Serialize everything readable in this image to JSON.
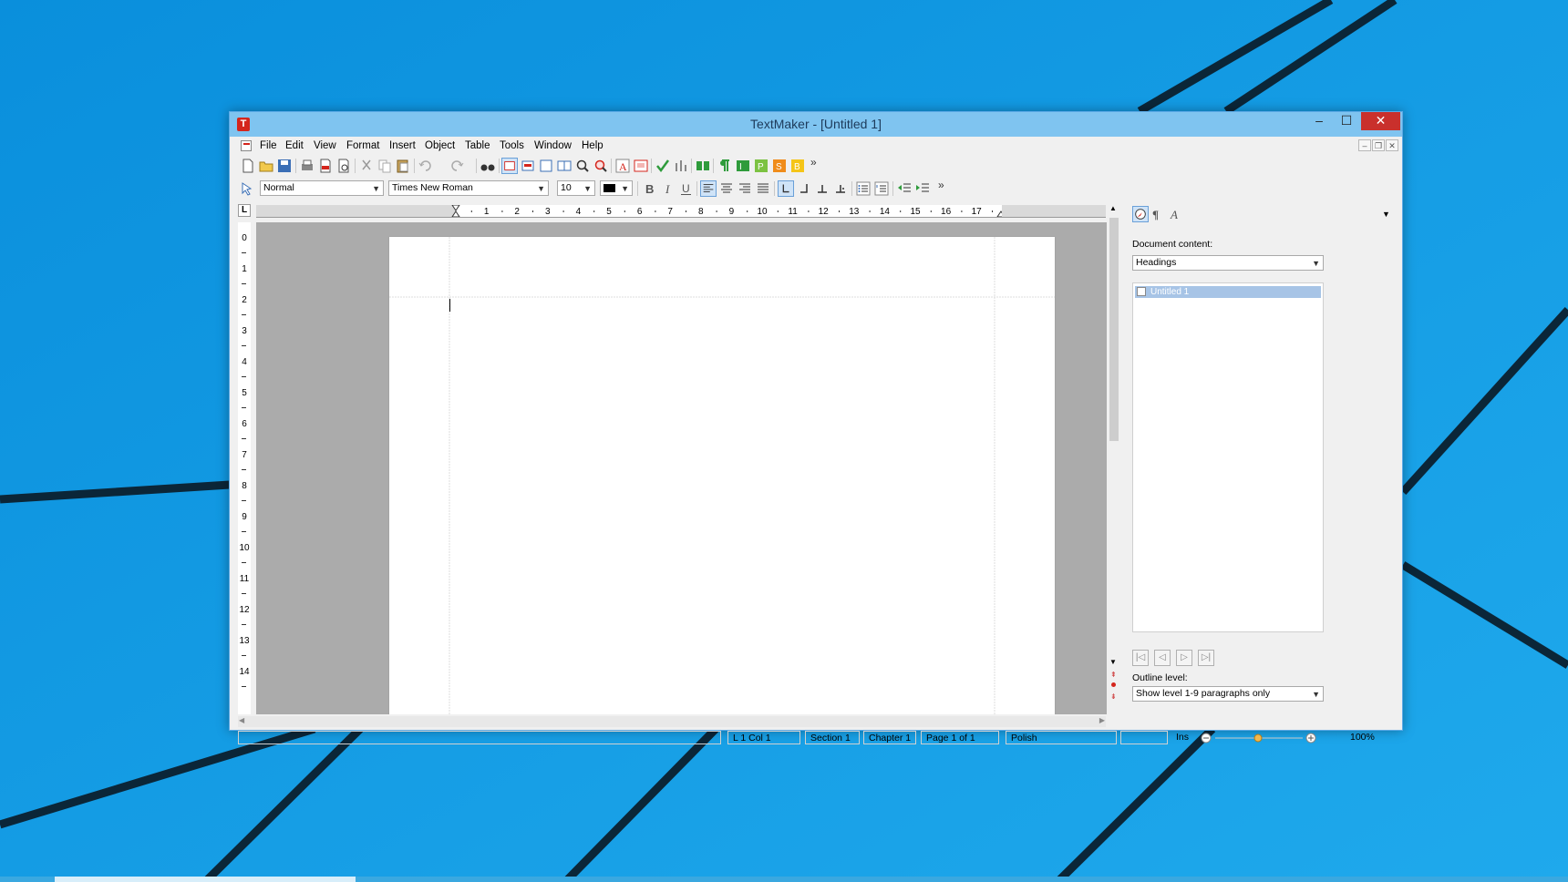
{
  "window": {
    "title": "TextMaker - [Untitled 1]",
    "app_icon_letter": "T",
    "controls": {
      "minimize": "–",
      "maximize": "☐",
      "close": "✕"
    }
  },
  "menu": [
    "File",
    "Edit",
    "View",
    "Format",
    "Insert",
    "Object",
    "Table",
    "Tools",
    "Window",
    "Help"
  ],
  "format_toolbar": {
    "paragraph_style": "Normal",
    "font_name": "Times New Roman",
    "font_size": "10"
  },
  "ruler": {
    "horizontal_labels": [
      "1",
      "2",
      "3",
      "4",
      "5",
      "6",
      "7",
      "8",
      "9",
      "10",
      "11",
      "12",
      "13",
      "14",
      "15",
      "16",
      "17"
    ],
    "vertical_labels": [
      "0",
      "1",
      "2",
      "3",
      "4",
      "5",
      "6",
      "7",
      "8",
      "9",
      "10",
      "11",
      "12",
      "13",
      "14"
    ],
    "corner": "L"
  },
  "sidebar": {
    "document_content_label": "Document content:",
    "document_content_value": "Headings",
    "list_items": [
      "Untitled 1"
    ],
    "outline_level_label": "Outline level:",
    "outline_level_value": "Show level 1-9 paragraphs only"
  },
  "statusbar": {
    "position": "L 1 Col 1",
    "section": "Section 1",
    "chapter": "Chapter 1",
    "page": "Page 1 of 1",
    "language": "Polish",
    "mode": "Ins",
    "zoom": "100%"
  },
  "colors": {
    "desktop": "#1a9de6",
    "titlebar": "#7fc4f0",
    "close_button": "#c9302c",
    "doc_area": "#ababab",
    "selection": "#a7c4e6"
  }
}
